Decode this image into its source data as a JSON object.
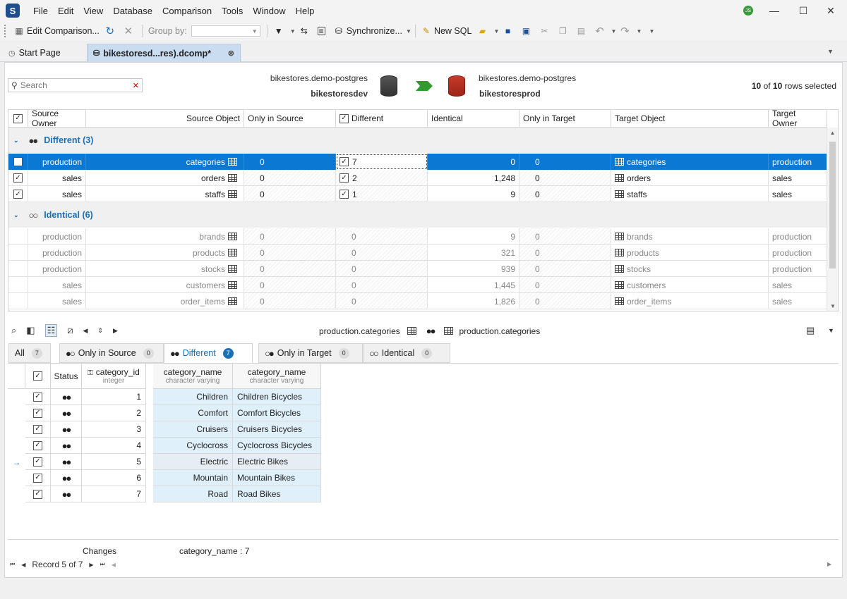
{
  "app": {
    "logo": "S"
  },
  "menu": [
    "File",
    "Edit",
    "View",
    "Database",
    "Comparison",
    "Tools",
    "Window",
    "Help"
  ],
  "user_initials": "JS",
  "window_controls": {
    "minimize": "—",
    "maximize": "☐",
    "close": "✕"
  },
  "toolbar": {
    "edit_comparison": "Edit Comparison...",
    "group_by_label": "Group by:",
    "group_by_value": "",
    "synchronize": "Synchronize...",
    "new_sql": "New SQL"
  },
  "tabs": [
    {
      "label": "Start Page"
    },
    {
      "label": "bikestoresd...res).dcomp*"
    }
  ],
  "search": {
    "placeholder": "Search"
  },
  "source": {
    "server": "bikestores.demo-postgres",
    "db": "bikestoresdev"
  },
  "target": {
    "server": "bikestores.demo-postgres",
    "db": "bikestoresprod"
  },
  "selection": {
    "selected": "10",
    "of": "of",
    "total": "10",
    "suffix": "rows selected"
  },
  "grid_headers": [
    "Source Owner",
    "Source Object",
    "Only in Source",
    "Different",
    "Identical",
    "Only in Target",
    "Target Object",
    "Target Owner"
  ],
  "groups": {
    "different": {
      "label": "Different (3)"
    },
    "identical": {
      "label": "Identical (6)"
    }
  },
  "different_rows": [
    {
      "source_owner": "production",
      "source_object": "categories",
      "only_in_source": "0",
      "different": "7",
      "identical": "0",
      "only_in_target": "0",
      "target_object": "categories",
      "target_owner": "production"
    },
    {
      "source_owner": "sales",
      "source_object": "orders",
      "only_in_source": "0",
      "different": "2",
      "identical": "1,248",
      "only_in_target": "0",
      "target_object": "orders",
      "target_owner": "sales"
    },
    {
      "source_owner": "sales",
      "source_object": "staffs",
      "only_in_source": "0",
      "different": "1",
      "identical": "9",
      "only_in_target": "0",
      "target_object": "staffs",
      "target_owner": "sales"
    }
  ],
  "identical_rows": [
    {
      "source_owner": "production",
      "source_object": "brands",
      "only_in_source": "0",
      "different": "0",
      "identical": "9",
      "only_in_target": "0",
      "target_object": "brands",
      "target_owner": "production"
    },
    {
      "source_owner": "production",
      "source_object": "products",
      "only_in_source": "0",
      "different": "0",
      "identical": "321",
      "only_in_target": "0",
      "target_object": "products",
      "target_owner": "production"
    },
    {
      "source_owner": "production",
      "source_object": "stocks",
      "only_in_source": "0",
      "different": "0",
      "identical": "939",
      "only_in_target": "0",
      "target_object": "stocks",
      "target_owner": "production"
    },
    {
      "source_owner": "sales",
      "source_object": "customers",
      "only_in_source": "0",
      "different": "0",
      "identical": "1,445",
      "only_in_target": "0",
      "target_object": "customers",
      "target_owner": "sales"
    },
    {
      "source_owner": "sales",
      "source_object": "order_items",
      "only_in_source": "0",
      "different": "0",
      "identical": "1,826",
      "only_in_target": "0",
      "target_object": "order_items",
      "target_owner": "sales"
    }
  ],
  "detail": {
    "source_name": "production.categories",
    "target_name": "production.categories",
    "tabs": [
      {
        "label": "All",
        "count": "7"
      },
      {
        "label": "Only in Source",
        "count": "0"
      },
      {
        "label": "Different",
        "count": "7"
      },
      {
        "label": "Only in Target",
        "count": "0"
      },
      {
        "label": "Identical",
        "count": "0"
      }
    ],
    "headers": {
      "status": "Status",
      "id_name": "category_id",
      "id_type": "integer",
      "src_name": "category_name",
      "src_type": "character varying",
      "tgt_name": "category_name",
      "tgt_type": "character varying"
    },
    "rows": [
      {
        "id": "1",
        "source": "Children",
        "target": "Children Bicycles"
      },
      {
        "id": "2",
        "source": "Comfort",
        "target": "Comfort Bicycles"
      },
      {
        "id": "3",
        "source": "Cruisers",
        "target": "Cruisers Bicycles"
      },
      {
        "id": "4",
        "source": "Cyclocross",
        "target": "Cyclocross Bicycles"
      },
      {
        "id": "5",
        "source": "Electric",
        "target": "Electric Bikes"
      },
      {
        "id": "6",
        "source": "Mountain",
        "target": "Mountain Bikes"
      },
      {
        "id": "7",
        "source": "Road",
        "target": "Road Bikes"
      }
    ],
    "changes_label": "Changes",
    "changes_value": "category_name : 7",
    "record_nav": "Record 5 of 7"
  }
}
